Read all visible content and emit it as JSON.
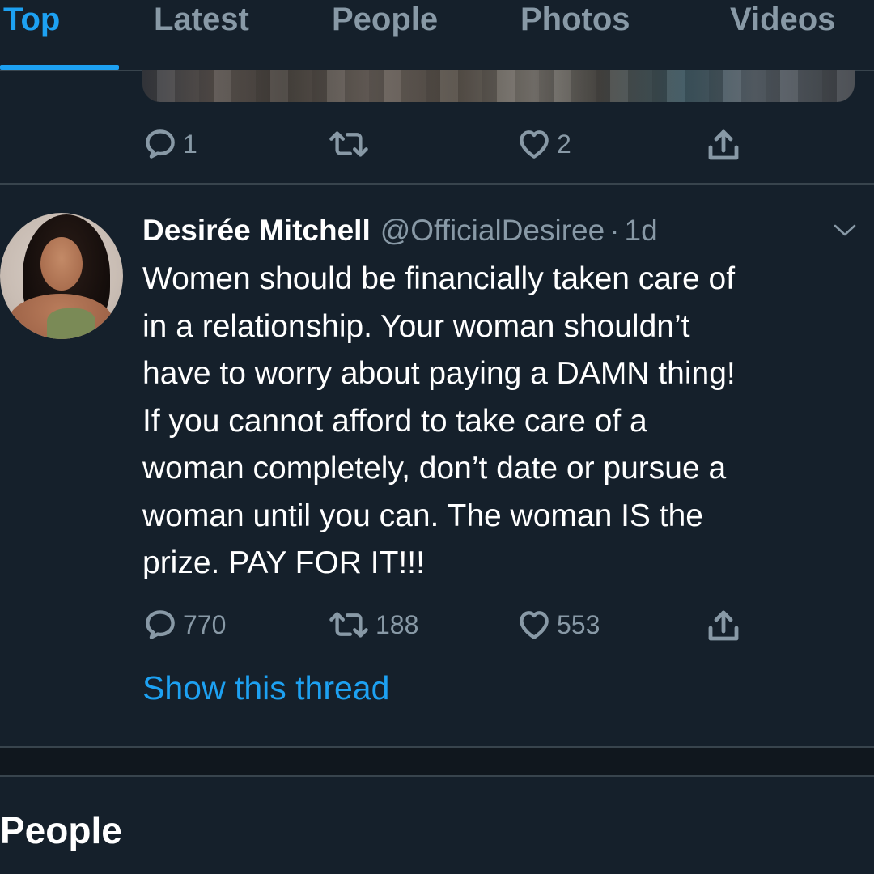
{
  "tabs": [
    {
      "label": "Top",
      "active": true
    },
    {
      "label": "Latest",
      "active": false
    },
    {
      "label": "People",
      "active": false
    },
    {
      "label": "Photos",
      "active": false
    },
    {
      "label": "Videos",
      "active": false
    }
  ],
  "previous_tweet": {
    "reply_count": "1",
    "retweet_count": "",
    "like_count": "2"
  },
  "tweet": {
    "name": "Desirée Mitchell",
    "handle": "@OfficialDesiree",
    "separator": "·",
    "time": "1d",
    "text_lines": [
      "Women should be financially taken care of",
      "in a relationship. Your woman shouldn’t",
      "have to worry about paying a DAMN thing!",
      "If you cannot afford to take care of a",
      "woman completely, don’t date or pursue a",
      "woman until you can. The woman IS the",
      "prize. PAY FOR IT!!!"
    ],
    "reply_count": "770",
    "retweet_count": "188",
    "like_count": "553",
    "show_thread": "Show this thread"
  },
  "section_title": "People",
  "colors": {
    "background": "#15202b",
    "accent": "#1da1f2",
    "muted": "#8899a6",
    "divider": "#38444d"
  },
  "icons": {
    "reply": "reply-icon",
    "retweet": "retweet-icon",
    "like": "heart-icon",
    "share": "share-icon",
    "more": "chevron-down-icon"
  }
}
